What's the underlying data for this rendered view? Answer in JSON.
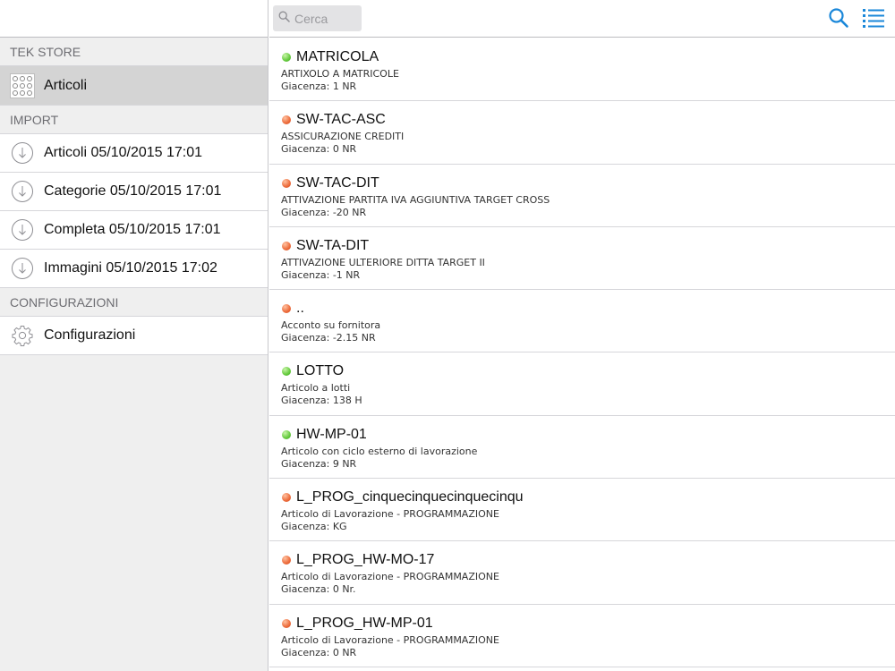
{
  "sidebar": {
    "sections": {
      "store": "TEK STORE",
      "import": "IMPORT",
      "config": "CONFIGURAZIONI"
    },
    "articoli_label": "Articoli",
    "imports": [
      {
        "label": "Articoli 05/10/2015 17:01"
      },
      {
        "label": "Categorie 05/10/2015 17:01"
      },
      {
        "label": "Completa 05/10/2015 17:01"
      },
      {
        "label": "Immagini 05/10/2015 17:02"
      }
    ],
    "config_label": "Configurazioni"
  },
  "search": {
    "placeholder": "Cerca"
  },
  "colors": {
    "accent": "#1a87d9",
    "status_green": "#63c93c",
    "status_red": "#ec6a3a"
  },
  "items": [
    {
      "status": "green",
      "code": "MATRICOLA",
      "desc": "ARTIXOLO A MATRICOLE",
      "stock": "Giacenza: 1 NR"
    },
    {
      "status": "red",
      "code": "SW-TAC-ASC",
      "desc": "ASSICURAZIONE CREDITI",
      "stock": "Giacenza: 0 NR"
    },
    {
      "status": "red",
      "code": "SW-TAC-DIT",
      "desc": "ATTIVAZIONE PARTITA IVA AGGIUNTIVA TARGET CROSS",
      "stock": "Giacenza: -20 NR"
    },
    {
      "status": "red",
      "code": "SW-TA-DIT",
      "desc": "ATTIVAZIONE ULTERIORE DITTA TARGET II",
      "stock": "Giacenza: -1 NR"
    },
    {
      "status": "red",
      "code": "..",
      "desc": "Acconto su fornitora",
      "stock": "Giacenza: -2.15 NR"
    },
    {
      "status": "green",
      "code": "LOTTO",
      "desc": "Articolo a lotti",
      "stock": "Giacenza: 138 H"
    },
    {
      "status": "green",
      "code": "HW-MP-01",
      "desc": "Articolo con ciclo esterno di lavorazione",
      "stock": "Giacenza: 9 NR"
    },
    {
      "status": "red",
      "code": "L_PROG_cinquecinquecinquecinqu",
      "desc": "Articolo di Lavorazione - PROGRAMMAZIONE",
      "stock": "Giacenza: KG"
    },
    {
      "status": "red",
      "code": "L_PROG_HW-MO-17",
      "desc": "Articolo di Lavorazione - PROGRAMMAZIONE",
      "stock": "Giacenza: 0 Nr."
    },
    {
      "status": "red",
      "code": "L_PROG_HW-MP-01",
      "desc": "Articolo di Lavorazione - PROGRAMMAZIONE",
      "stock": "Giacenza: 0 NR"
    }
  ]
}
